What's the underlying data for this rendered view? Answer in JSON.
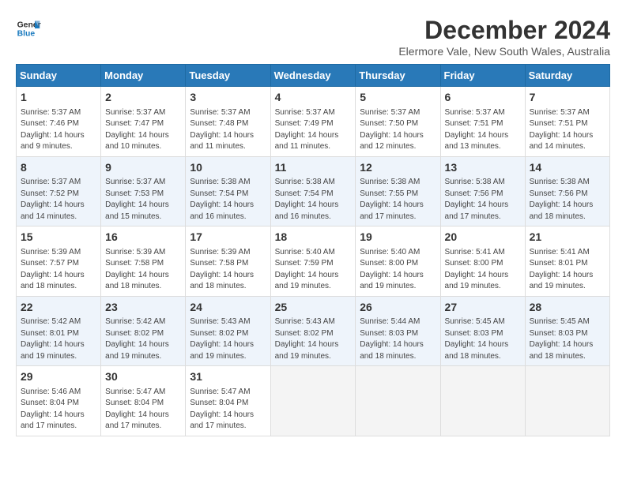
{
  "logo": {
    "line1": "General",
    "line2": "Blue"
  },
  "title": "December 2024",
  "subtitle": "Elermore Vale, New South Wales, Australia",
  "weekdays": [
    "Sunday",
    "Monday",
    "Tuesday",
    "Wednesday",
    "Thursday",
    "Friday",
    "Saturday"
  ],
  "weeks": [
    [
      {
        "day": 1,
        "sunrise": "5:37 AM",
        "sunset": "7:46 PM",
        "daylight": "14 hours and 9 minutes."
      },
      {
        "day": 2,
        "sunrise": "5:37 AM",
        "sunset": "7:47 PM",
        "daylight": "14 hours and 10 minutes."
      },
      {
        "day": 3,
        "sunrise": "5:37 AM",
        "sunset": "7:48 PM",
        "daylight": "14 hours and 11 minutes."
      },
      {
        "day": 4,
        "sunrise": "5:37 AM",
        "sunset": "7:49 PM",
        "daylight": "14 hours and 11 minutes."
      },
      {
        "day": 5,
        "sunrise": "5:37 AM",
        "sunset": "7:50 PM",
        "daylight": "14 hours and 12 minutes."
      },
      {
        "day": 6,
        "sunrise": "5:37 AM",
        "sunset": "7:51 PM",
        "daylight": "14 hours and 13 minutes."
      },
      {
        "day": 7,
        "sunrise": "5:37 AM",
        "sunset": "7:51 PM",
        "daylight": "14 hours and 14 minutes."
      }
    ],
    [
      {
        "day": 8,
        "sunrise": "5:37 AM",
        "sunset": "7:52 PM",
        "daylight": "14 hours and 14 minutes."
      },
      {
        "day": 9,
        "sunrise": "5:37 AM",
        "sunset": "7:53 PM",
        "daylight": "14 hours and 15 minutes."
      },
      {
        "day": 10,
        "sunrise": "5:38 AM",
        "sunset": "7:54 PM",
        "daylight": "14 hours and 16 minutes."
      },
      {
        "day": 11,
        "sunrise": "5:38 AM",
        "sunset": "7:54 PM",
        "daylight": "14 hours and 16 minutes."
      },
      {
        "day": 12,
        "sunrise": "5:38 AM",
        "sunset": "7:55 PM",
        "daylight": "14 hours and 17 minutes."
      },
      {
        "day": 13,
        "sunrise": "5:38 AM",
        "sunset": "7:56 PM",
        "daylight": "14 hours and 17 minutes."
      },
      {
        "day": 14,
        "sunrise": "5:38 AM",
        "sunset": "7:56 PM",
        "daylight": "14 hours and 18 minutes."
      }
    ],
    [
      {
        "day": 15,
        "sunrise": "5:39 AM",
        "sunset": "7:57 PM",
        "daylight": "14 hours and 18 minutes."
      },
      {
        "day": 16,
        "sunrise": "5:39 AM",
        "sunset": "7:58 PM",
        "daylight": "14 hours and 18 minutes."
      },
      {
        "day": 17,
        "sunrise": "5:39 AM",
        "sunset": "7:58 PM",
        "daylight": "14 hours and 18 minutes."
      },
      {
        "day": 18,
        "sunrise": "5:40 AM",
        "sunset": "7:59 PM",
        "daylight": "14 hours and 19 minutes."
      },
      {
        "day": 19,
        "sunrise": "5:40 AM",
        "sunset": "8:00 PM",
        "daylight": "14 hours and 19 minutes."
      },
      {
        "day": 20,
        "sunrise": "5:41 AM",
        "sunset": "8:00 PM",
        "daylight": "14 hours and 19 minutes."
      },
      {
        "day": 21,
        "sunrise": "5:41 AM",
        "sunset": "8:01 PM",
        "daylight": "14 hours and 19 minutes."
      }
    ],
    [
      {
        "day": 22,
        "sunrise": "5:42 AM",
        "sunset": "8:01 PM",
        "daylight": "14 hours and 19 minutes."
      },
      {
        "day": 23,
        "sunrise": "5:42 AM",
        "sunset": "8:02 PM",
        "daylight": "14 hours and 19 minutes."
      },
      {
        "day": 24,
        "sunrise": "5:43 AM",
        "sunset": "8:02 PM",
        "daylight": "14 hours and 19 minutes."
      },
      {
        "day": 25,
        "sunrise": "5:43 AM",
        "sunset": "8:02 PM",
        "daylight": "14 hours and 19 minutes."
      },
      {
        "day": 26,
        "sunrise": "5:44 AM",
        "sunset": "8:03 PM",
        "daylight": "14 hours and 18 minutes."
      },
      {
        "day": 27,
        "sunrise": "5:45 AM",
        "sunset": "8:03 PM",
        "daylight": "14 hours and 18 minutes."
      },
      {
        "day": 28,
        "sunrise": "5:45 AM",
        "sunset": "8:03 PM",
        "daylight": "14 hours and 18 minutes."
      }
    ],
    [
      {
        "day": 29,
        "sunrise": "5:46 AM",
        "sunset": "8:04 PM",
        "daylight": "14 hours and 17 minutes."
      },
      {
        "day": 30,
        "sunrise": "5:47 AM",
        "sunset": "8:04 PM",
        "daylight": "14 hours and 17 minutes."
      },
      {
        "day": 31,
        "sunrise": "5:47 AM",
        "sunset": "8:04 PM",
        "daylight": "14 hours and 17 minutes."
      },
      null,
      null,
      null,
      null
    ]
  ]
}
